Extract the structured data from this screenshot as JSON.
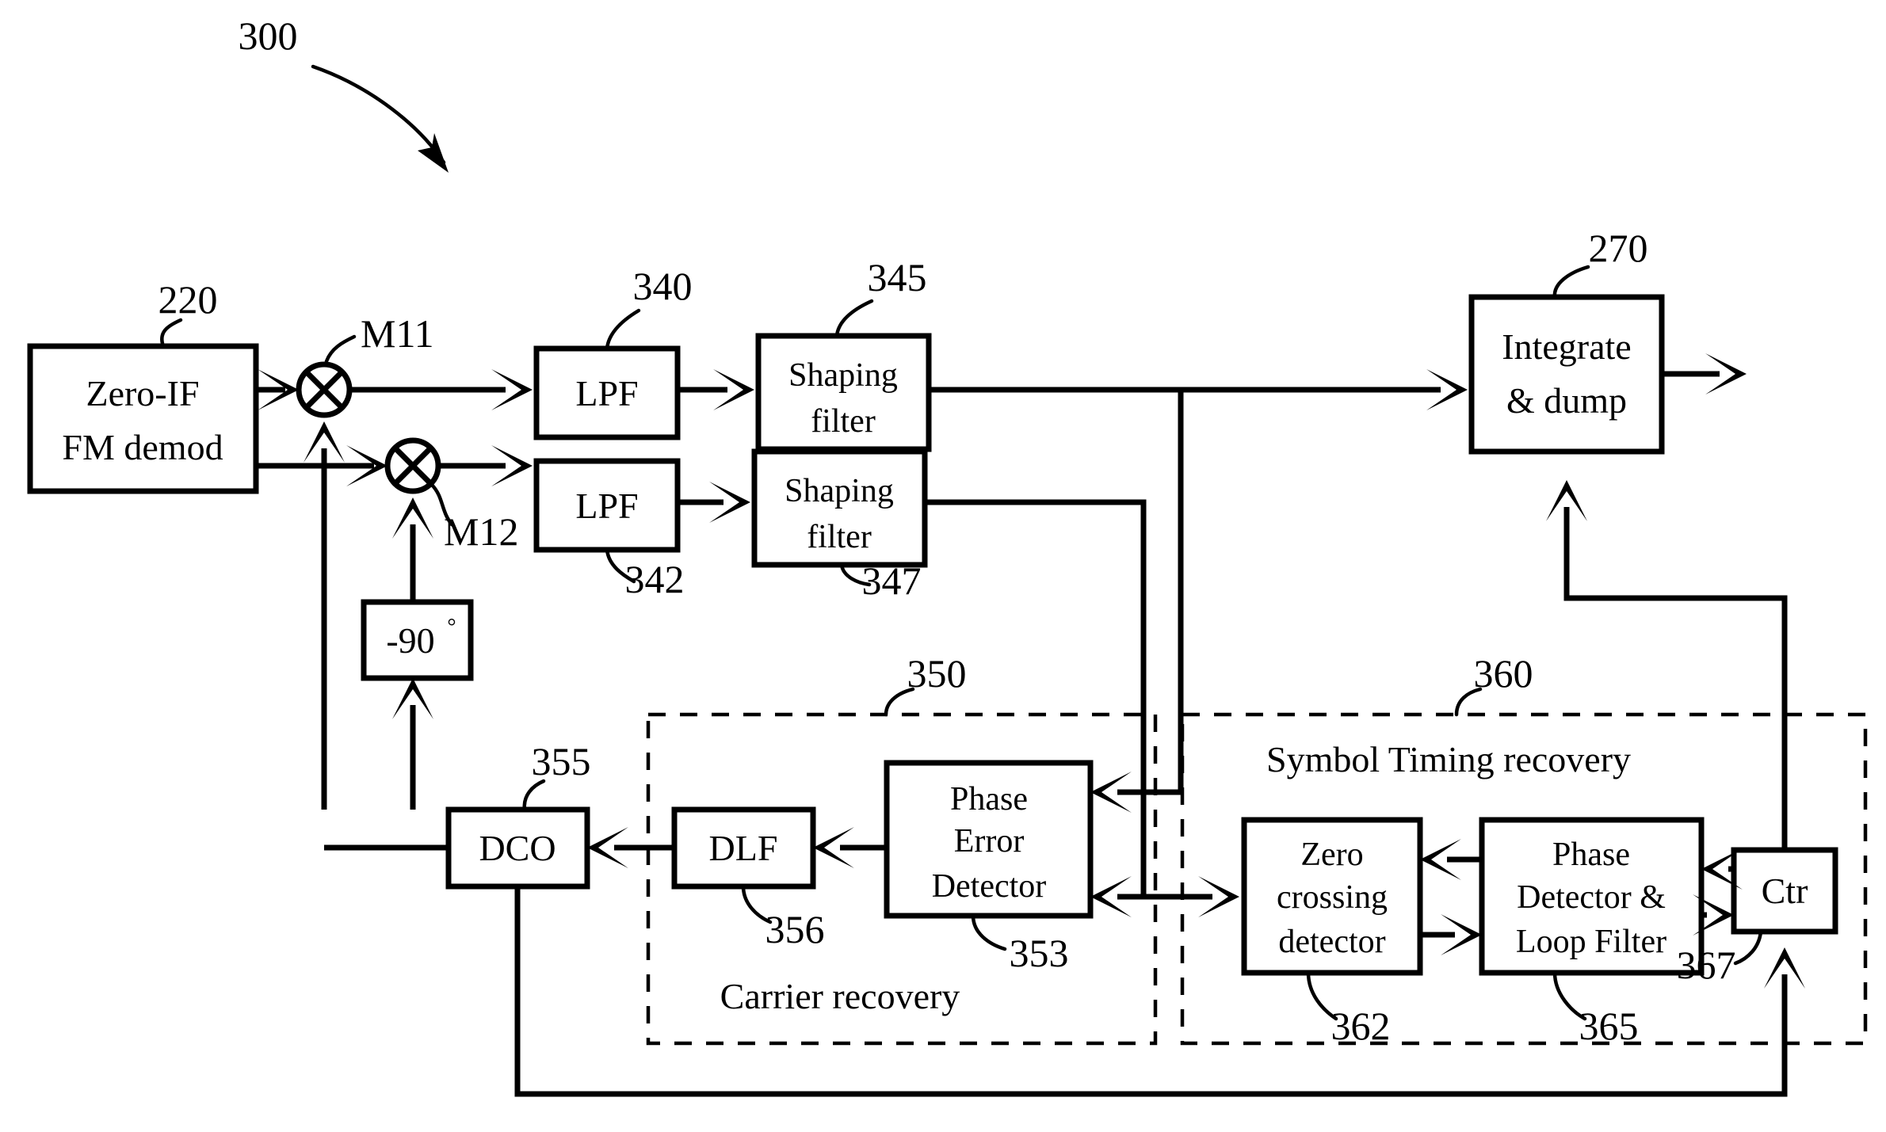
{
  "figure": {
    "number": "300",
    "title_ref": "300"
  },
  "blocks": {
    "zero_if": {
      "label_line1": "Zero-IF",
      "label_line2": "FM demod",
      "ref": "220"
    },
    "lpf_i": {
      "label": "LPF",
      "ref": "340"
    },
    "lpf_q": {
      "label": "LPF",
      "ref": "342"
    },
    "shaping_i": {
      "label_line1": "Shaping",
      "label_line2": "filter",
      "ref": "345"
    },
    "shaping_q": {
      "label_line1": "Shaping",
      "label_line2": "filter",
      "ref": "347"
    },
    "integrate_dump": {
      "label_line1": "Integrate",
      "label_line2": "& dump",
      "ref": "270"
    },
    "phase_shift": {
      "label": "-90",
      "unit": "°"
    },
    "dco": {
      "label": "DCO",
      "ref": "355"
    },
    "dlf": {
      "label": "DLF",
      "ref": "356"
    },
    "phase_error_detector": {
      "label_line1": "Phase",
      "label_line2": "Error",
      "label_line3": "Detector",
      "ref": "353"
    },
    "zero_crossing_detector": {
      "label_line1": "Zero",
      "label_line2": "crossing",
      "label_line3": "detector",
      "ref": "362"
    },
    "phase_detector_loop_filter": {
      "label_line1": "Phase",
      "label_line2": "Detector &",
      "label_line3": "Loop Filter",
      "ref": "365"
    },
    "ctr": {
      "label": "Ctr",
      "ref": "367"
    }
  },
  "mixers": {
    "m11": {
      "label": "M11"
    },
    "m12": {
      "label": "M12"
    }
  },
  "groups": {
    "carrier_recovery": {
      "label": "Carrier recovery",
      "ref": "350"
    },
    "symbol_timing_recovery": {
      "label": "Symbol Timing recovery",
      "ref": "360"
    }
  },
  "colors": {
    "line": "#000000",
    "fill": "#ffffff"
  }
}
